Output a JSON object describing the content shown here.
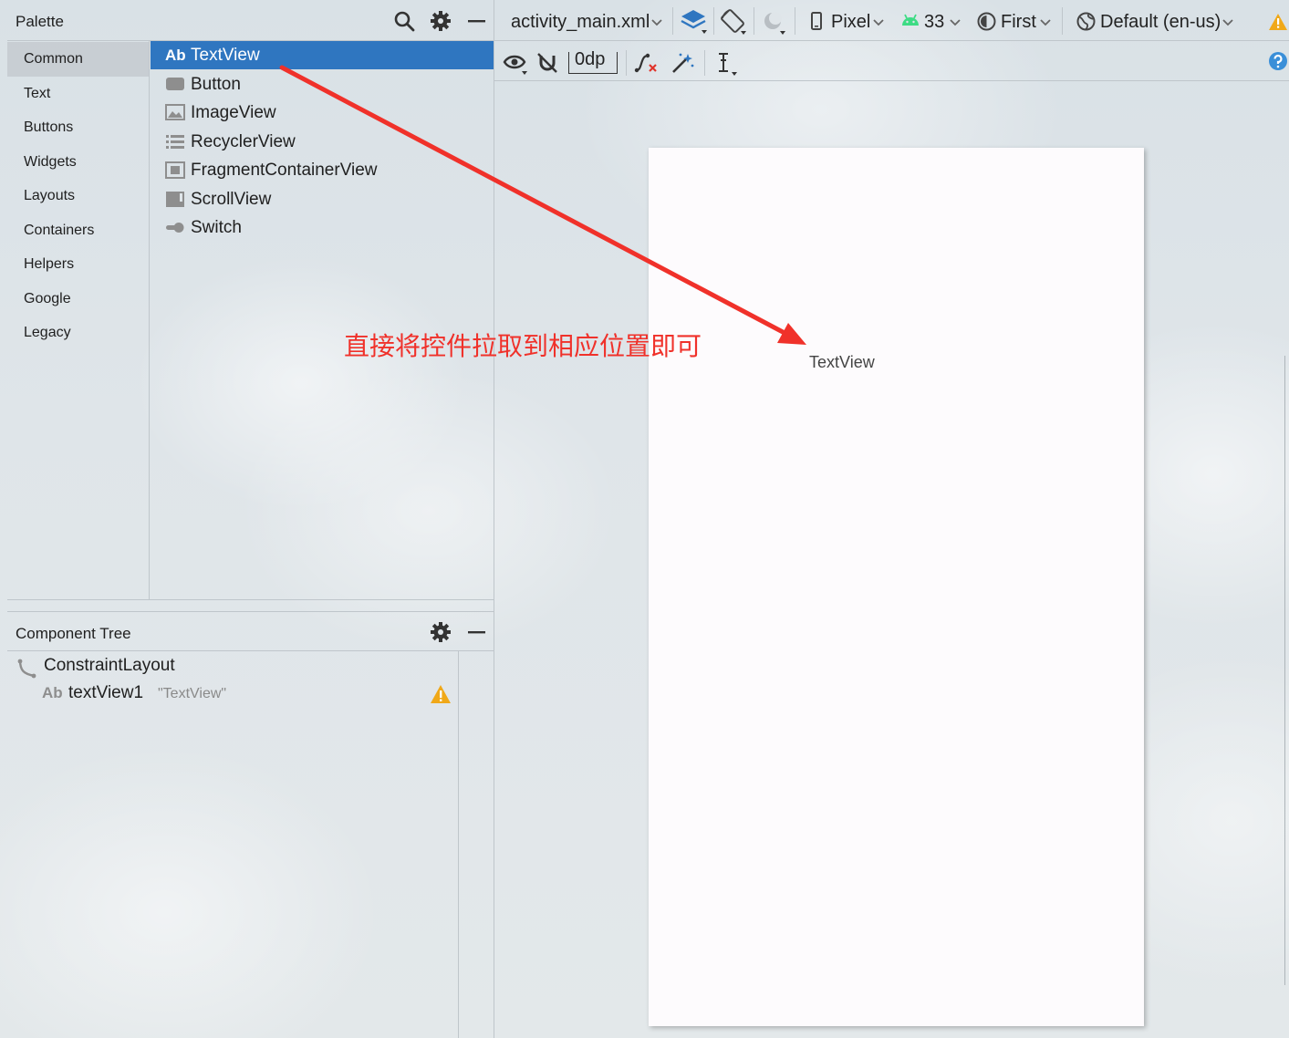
{
  "palette": {
    "title": "Palette",
    "categories": [
      "Common",
      "Text",
      "Buttons",
      "Widgets",
      "Layouts",
      "Containers",
      "Helpers",
      "Google",
      "Legacy"
    ],
    "selected_category": "Common",
    "widgets": [
      {
        "label": "TextView",
        "icon": "ab-text-icon",
        "selected": true
      },
      {
        "label": "Button",
        "icon": "button-icon",
        "selected": false
      },
      {
        "label": "ImageView",
        "icon": "image-icon",
        "selected": false
      },
      {
        "label": "RecyclerView",
        "icon": "list-icon",
        "selected": false
      },
      {
        "label": "FragmentContainerView",
        "icon": "fragment-icon",
        "selected": false
      },
      {
        "label": "ScrollView",
        "icon": "scroll-icon",
        "selected": false
      },
      {
        "label": "Switch",
        "icon": "switch-icon",
        "selected": false
      }
    ],
    "ab_prefix": "Ab"
  },
  "component_tree": {
    "title": "Component Tree",
    "root": "ConstraintLayout",
    "child_prefix": "Ab",
    "child_id": "textView1",
    "child_text": "\"TextView\""
  },
  "toolbar": {
    "file": "activity_main.xml",
    "device": "Pixel",
    "api": "33",
    "theme": "First",
    "locale": "Default (en-us)",
    "margin": "0dp"
  },
  "canvas": {
    "textview_label": "TextView"
  },
  "annotation": {
    "text": "直接将控件拉取到相应位置即可",
    "color": "#f0312a"
  },
  "colors": {
    "selection": "#2f76c0",
    "warning": "#f0a818",
    "android_green": "#3ddc84",
    "help_blue": "#3a8fd8"
  }
}
